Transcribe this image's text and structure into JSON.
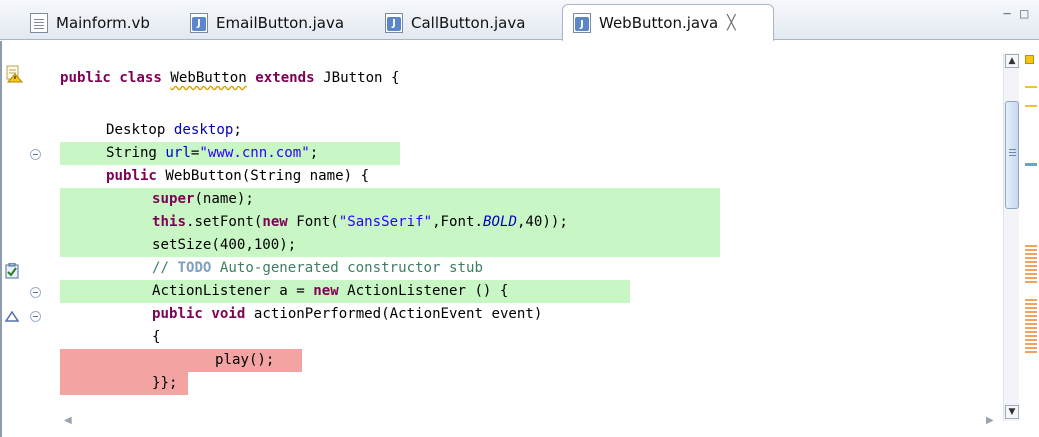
{
  "tabs": [
    {
      "label": "Mainform.vb",
      "icon": "vb-file-icon",
      "active": false
    },
    {
      "label": "EmailButton.java",
      "icon": "java-file-icon",
      "active": false
    },
    {
      "label": "CallButton.java",
      "icon": "java-file-icon",
      "active": false
    },
    {
      "label": "WebButton.java",
      "icon": "java-file-icon",
      "active": true,
      "close": "╳"
    }
  ],
  "window_controls": {
    "minimize": "−",
    "maximize": "□"
  },
  "code": {
    "l1": {
      "kw1": "public",
      "kw2": "class",
      "name": "WebButton",
      "kw3": "extends",
      "rest": "JButton {"
    },
    "l2": "",
    "l3": {
      "type": "Desktop",
      "field": "desktop",
      "rest": ";"
    },
    "l4": {
      "type": "String",
      "field": "url",
      "eq": "=",
      "str": "\"www.cnn.com\"",
      "rest": ";"
    },
    "l5": {
      "kw": "public",
      "rest": "WebButton(String name) {"
    },
    "l6": {
      "kw": "super",
      "rest": "(name);"
    },
    "l7": {
      "kw1": "this",
      "a": ".setFont(",
      "kw2": "new",
      "b": " Font(",
      "str": "\"SansSerif\"",
      "c": ",Font.",
      "ital": "BOLD",
      "d": ",40));"
    },
    "l8": "setSize(400,100);",
    "l9": {
      "prefix": "// ",
      "todo": "TODO",
      "text": " Auto-generated constructor stub"
    },
    "l10": {
      "a": "ActionListener a = ",
      "kw": "new",
      "b": " ActionListener () {"
    },
    "l11": {
      "kw1": "public",
      "kw2": "void",
      "rest": "actionPerformed(ActionEvent event)"
    },
    "l12": "{",
    "l13": "play();",
    "l14": "}};"
  },
  "colors": {
    "keyword": "#7f0055",
    "field": "#0000c0",
    "string": "#2a00ff",
    "comment": "#3f7f5f",
    "added_highlight": "#c8f7c5",
    "removed_highlight": "#f4a3a3"
  },
  "gutter_icons": [
    "warning-icon",
    "task-icon",
    "fold-collapse-icon",
    "breakpoint-marker-icon"
  ],
  "scrollbars": {
    "up": "▲",
    "down": "▼",
    "left": "◀",
    "right": "▶"
  }
}
